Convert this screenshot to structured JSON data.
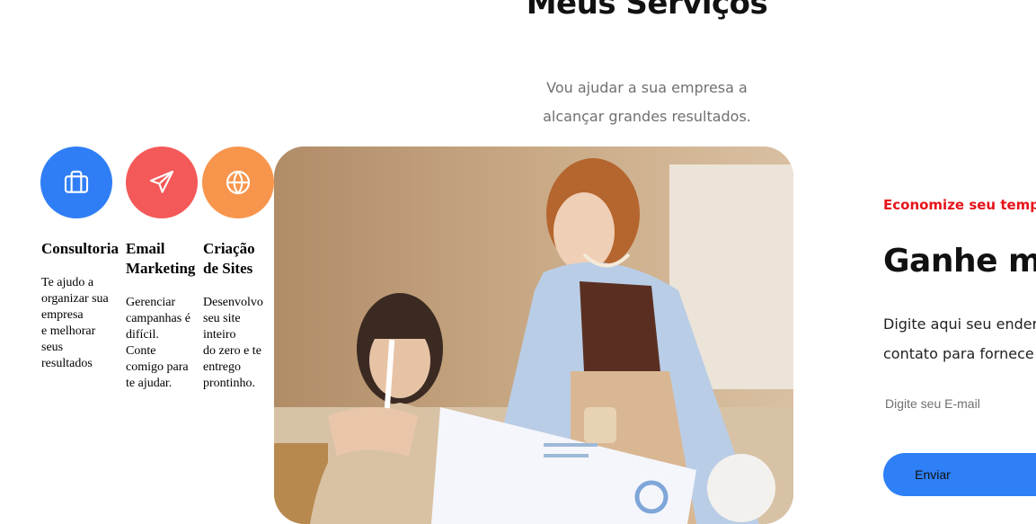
{
  "services_section": {
    "title": "Meus Serviços",
    "subtitle_line1": "Vou ajudar a sua empresa a",
    "subtitle_line2": "alcançar grandes resultados.",
    "items": [
      {
        "icon": "briefcase-icon",
        "color": "#2f7ef6",
        "title": "Consultoria",
        "description": "Te ajudo a\norganizar sua\nempresa\ne melhorar\nseus\nresultados"
      },
      {
        "icon": "paper-plane-icon",
        "color": "#f4595a",
        "title": "Email Marketing",
        "description": "Gerenciar\ncampanhas é\ndifícil.\nConte\ncomigo para\nte ajudar."
      },
      {
        "icon": "globe-icon",
        "color": "#f7954c",
        "title": "Criação de Sites",
        "description": "Desenvolvo\nseu site\ninteiro\ndo zero e te\nentrego\nprontinho."
      }
    ]
  },
  "newsletter": {
    "eyebrow": "Economize seu temp",
    "title": "Ganhe me",
    "text": "Digite aqui seu ender\ncontato para fornece",
    "email_placeholder": "Digite seu E-mail",
    "send_label": "Enviar",
    "accent_color": "#2f80f7",
    "eyebrow_color": "#e6141b"
  }
}
